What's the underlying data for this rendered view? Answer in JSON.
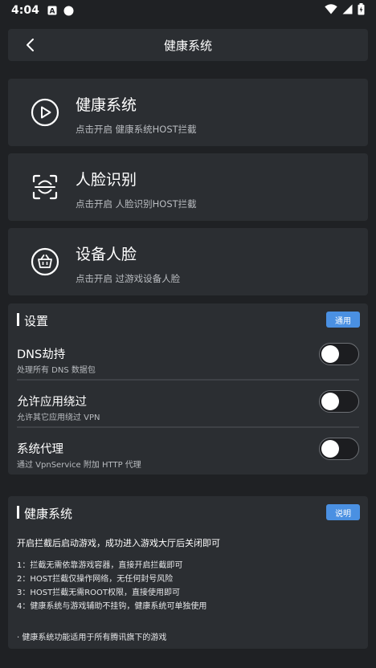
{
  "status_bar": {
    "time": "4:04",
    "icons": [
      "a-box-icon",
      "circle-icon",
      "wifi-icon",
      "signal-icon",
      "battery-icon"
    ]
  },
  "app_bar": {
    "title": "健康系统",
    "back_icon": "chevron-left-icon"
  },
  "features": [
    {
      "title": "健康系统",
      "subtitle": "点击开启 健康系统HOST拦截",
      "icon": "play-circle-icon"
    },
    {
      "title": "人脸识别",
      "subtitle": "点击开启 人脸识别HOST拦截",
      "icon": "face-scan-icon"
    },
    {
      "title": "设备人脸",
      "subtitle": "点击开启 过游戏设备人脸",
      "icon": "basket-circle-icon"
    }
  ],
  "settings": {
    "title": "设置",
    "badge": "通用",
    "items": [
      {
        "title": "DNS劫持",
        "desc": "处理所有 DNS 数据包",
        "enabled": false
      },
      {
        "title": "允许应用绕过",
        "desc": "允许其它应用绕过 VPN",
        "enabled": false
      },
      {
        "title": "系统代理",
        "desc": "通过 VpnService 附加 HTTP 代理",
        "enabled": false
      }
    ]
  },
  "info": {
    "title": "健康系统",
    "badge": "说明",
    "intro": "开启拦截后启动游戏，成功进入游戏大厅后关闭即可",
    "points": [
      "1：拦截无需依靠游戏容器，直接开启拦截即可",
      "2：HOST拦截仅操作网络，无任何封号风险",
      "3：HOST拦截无需ROOT权限，直接使用即可",
      "4：健康系统与游戏辅助不挂钩，健康系统可单独使用"
    ],
    "note": "· 健康系统功能适用于所有腾讯旗下的游戏"
  },
  "colors": {
    "background": "#1f2124",
    "card": "#2b2e32",
    "accent": "#4a90e2",
    "subtext": "#b9bcc0"
  }
}
